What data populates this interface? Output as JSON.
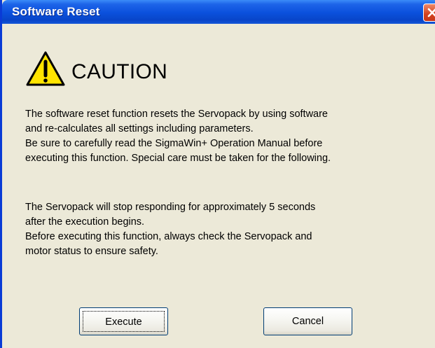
{
  "window": {
    "title": "Software Reset"
  },
  "caution": {
    "icon": "warning-triangle-icon",
    "heading": "CAUTION"
  },
  "message": {
    "paragraph1": [
      "The software reset function resets the Servopack by using software",
      "and re-calculates all settings including parameters.",
      "Be sure to carefully read the SigmaWin+ Operation Manual before",
      "executing this function. Special care must be taken for the following."
    ],
    "paragraph2": [
      "The Servopack will stop responding for approximately 5 seconds",
      "after  the execution begins.",
      "Before executing this function, always check the Servopack and",
      "motor status to ensure safety."
    ]
  },
  "buttons": {
    "execute_label": "Execute",
    "cancel_label": "Cancel"
  },
  "colors": {
    "titlebar": "#0a50dc",
    "dialog_background": "#ece9d8",
    "close_button": "#d3411e"
  }
}
